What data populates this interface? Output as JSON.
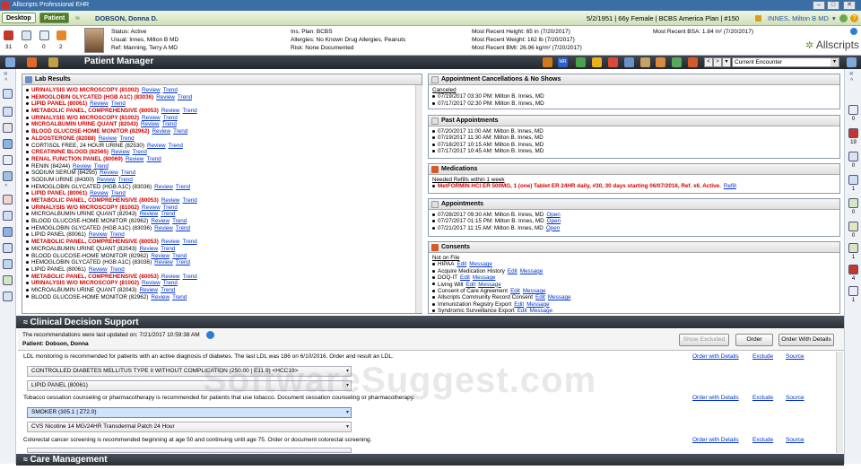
{
  "window": {
    "title": "Allscripts Professional EHR",
    "min": "–",
    "max": "□",
    "close": "✕"
  },
  "patient_bar": {
    "tab_desktop": "Desktop",
    "tab_patient": "Patient",
    "name": "DOBSON, Donna D.",
    "info": "5/2/1951 | 66y Female | BCBS America Plan | #150",
    "user": "INNES, Milton B MD"
  },
  "header": {
    "counts": [
      "31",
      "0",
      "0",
      "2"
    ],
    "status": "Status: Active",
    "usual": "Usual: Innes, Milton B MD",
    "ref": "Ref: Manning, Terry A MD",
    "plan": "Ins. Plan: BCBS",
    "allergies": "Allergies: No Known Drug Allergies, Peanuts",
    "risk": "Risk: None Documented",
    "height": "Most Recent Height: 65 in (7/20/2017)",
    "weight": "Most Recent Weight: 162 lb (7/20/2017)",
    "bmi": "Most Recent BMI: 26.96 kg/m² (7/20/2017)",
    "bsa": "Most Recent BSA: 1.84 m² (7/20/2017)",
    "brand": "Allscripts"
  },
  "pm_bar": {
    "title": "Patient Manager",
    "encounter": "Current Encounter",
    "wr": "WR"
  },
  "lab_results": {
    "title": "Lab Results",
    "review": "Review",
    "trend": "Trend",
    "rows": [
      {
        "t": "URINALYSIS W/O MICROSCOPY (81002)",
        "red": true
      },
      {
        "t": "HEMOGLOBIN GLYCATED (HGB A1C) (83036)",
        "red": true
      },
      {
        "t": "LIPID PANEL (80061)",
        "red": true
      },
      {
        "t": "METABOLIC PANEL, COMPREHENSIVE (80053)",
        "red": true
      },
      {
        "t": "URINALYSIS W/O MICROSCOPY (81002)",
        "red": true
      },
      {
        "t": "MICROALBUMIN URINE QUANT (82043)",
        "red": true
      },
      {
        "t": "BLOOD GLUCOSE-HOME MONITOR (82962)",
        "red": true
      },
      {
        "t": "ALDOSTERONE (82088)",
        "red": true
      },
      {
        "t": "CORTISOL FREE, 24 HOUR URINE (82530)",
        "red": false
      },
      {
        "t": "CREATININE BLOOD (82565)",
        "red": true
      },
      {
        "t": "RENAL FUNCTION PANEL (80069)",
        "red": true
      },
      {
        "t": "RENIN (84244)",
        "red": false
      },
      {
        "t": "SODIUM SERUM (84295)",
        "red": false
      },
      {
        "t": "SODIUM URINE (84300)",
        "red": false
      },
      {
        "t": "HEMOGLOBIN GLYCATED (HGB A1C) (83036)",
        "red": false
      },
      {
        "t": "LIPID PANEL (80061)",
        "red": true
      },
      {
        "t": "METABOLIC PANEL, COMPREHENSIVE (80053)",
        "red": true
      },
      {
        "t": "URINALYSIS W/O MICROSCOPY (81002)",
        "red": true
      },
      {
        "t": "MICROALBUMIN URINE QUANT (82043)",
        "red": false
      },
      {
        "t": "BLOOD GLUCOSE-HOME MONITOR (82962)",
        "red": false
      },
      {
        "t": "HEMOGLOBIN GLYCATED (HGB A1C) (83036)",
        "red": false
      },
      {
        "t": "LIPID PANEL (80061)",
        "red": false
      },
      {
        "t": "METABOLIC PANEL, COMPREHENSIVE (80053)",
        "red": true
      },
      {
        "t": "MICROALBUMIN URINE QUANT (82043)",
        "red": false
      },
      {
        "t": "BLOOD GLUCOSE-HOME MONITOR (82962)",
        "red": false
      },
      {
        "t": "HEMOGLOBIN GLYCATED (HGB A1C) (83036)",
        "red": false
      },
      {
        "t": "LIPID PANEL (80061)",
        "red": false
      },
      {
        "t": "METABOLIC PANEL, COMPREHENSIVE (80053)",
        "red": true
      },
      {
        "t": "URINALYSIS W/O MICROSCOPY (81002)",
        "red": true
      },
      {
        "t": "MICROALBUMIN URINE QUANT (82043)",
        "red": false
      },
      {
        "t": "BLOOD GLUCOSE-HOME MONITOR (82962)",
        "red": false
      }
    ]
  },
  "cancellations": {
    "title": "Appointment Cancellations & No Shows",
    "sub": "Canceled",
    "rows": [
      "07/19/2017 03:30 PM: Milton B. Innes, MD",
      "07/17/2017 02:30 PM: Milton B. Innes, MD"
    ]
  },
  "past_appointments": {
    "title": "Past Appointments",
    "rows": [
      "07/20/2017 11:00 AM: Milton B. Innes, MD",
      "07/19/2017 11:30 AM: Milton B. Innes, MD",
      "07/18/2017 10:15 AM: Milton B. Innes, MD",
      "07/17/2017 10:45 AM: Milton B. Innes, MD"
    ]
  },
  "medications": {
    "title": "Medications",
    "sub": "Needed Refills within 1 week",
    "row": "MetFORMIN HCl ER 500MG, 1 (one) Tablet ER 24HR daily, #30, 30 days starting 06/07/2016, Ref. x6. Active.",
    "refill": "Refill"
  },
  "appointments": {
    "title": "Appointments",
    "open": "Open",
    "rows": [
      "07/28/2017 09:30 AM: Milton B. Innes, MD",
      "07/27/2017 01:15 PM: Milton B. Innes, MD",
      "07/21/2017 11:15 AM: Milton B. Innes, MD"
    ]
  },
  "consents": {
    "title": "Consents",
    "sub": "Not on File",
    "edit": "Edit",
    "message": "Message",
    "rows": [
      "HIPAA",
      "Acquire Medication History",
      "DOQ-IT",
      "Living Will",
      "Consent of Care Agreement",
      "Allscripts Community Record Consent",
      "Immunization Registry Export",
      "Syndromic Surveillance Export"
    ]
  },
  "cds": {
    "title": "Clinical Decision Support",
    "updated": "The recommendations were last updated on:  7/21/2017 10:59:38 AM",
    "patient": "Patient: Dobson, Donna",
    "btn_show": "Show Excluded",
    "btn_order": "Order",
    "btn_details": "Order With Details",
    "order_details": "Order with Details",
    "exclude": "Exclude",
    "source": "Source",
    "rec1": "LDL monitoring is recommended for patients with an active diagnosis of diabetes. The last LDL was 186 on 6/10/2016. Order and result an LDL.",
    "sel1a": "CONTROLLED DIABETES MELLITUS TYPE II WITHOUT COMPLICATION (250.00 | E11.9) <HCC19>",
    "sel1b": "LIPID PANEL (80061)",
    "rec2": "Tobacco cessation counseling or pharmacotherapy is recommended for patients that use tobacco. Document cessation counseling or pharmacotherapy.",
    "sel2a": "SMOKER (305.1 | Z72.0)",
    "sel2b": "CVS Nicotine 14 MG/24HR Transdermal Patch 24 Hour",
    "rec3": "Colorectal cancer screening is recommended beginning at age 50 and continuing until age 75. Order or document colorectal screening."
  },
  "care_management": {
    "title": "Care Management"
  },
  "right_counts": [
    "0",
    "19",
    "0",
    "1",
    "0",
    "0",
    "1",
    "4",
    "1"
  ],
  "watermark": "SoftwareSuggest.com"
}
